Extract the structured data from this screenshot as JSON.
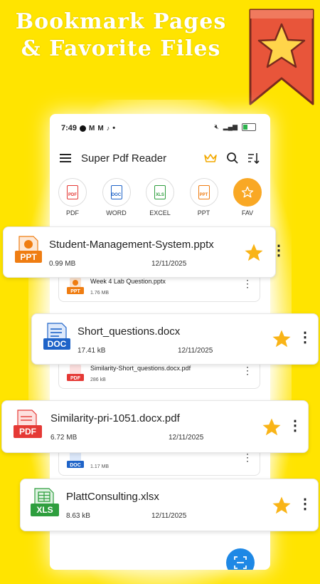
{
  "headline": {
    "line1": "Bookmark Pages",
    "line2": "& Favorite Files"
  },
  "status": {
    "time": "7:49",
    "dot": "•"
  },
  "app": {
    "title": "Super Pdf Reader"
  },
  "categories": [
    {
      "label": "PDF",
      "glyph": "PDF",
      "color": "#e53935"
    },
    {
      "label": "WORD",
      "glyph": "DOC",
      "color": "#1e63c8"
    },
    {
      "label": "EXCEL",
      "glyph": "XLS",
      "color": "#2e9e3e"
    },
    {
      "label": "PPT",
      "glyph": "PPT",
      "color": "#ef7d12"
    },
    {
      "label": "FAV",
      "glyph": "star",
      "color": "#f9a825"
    }
  ],
  "background_list": [
    {
      "name": "Week 4 Lab Question.pptx",
      "size": "1.76 MB",
      "type": "PPT"
    },
    {
      "name": "Similarity-Short_questions.docx.pdf",
      "size": "286 kB",
      "type": "PDF"
    },
    {
      "name": "",
      "size": "1.17 MB",
      "type": "DOC"
    }
  ],
  "featured_files": [
    {
      "name": "Student-Management-System.pptx",
      "size": "0.99 MB",
      "date": "12/11/2025",
      "type": "PPT"
    },
    {
      "name": "Short_questions.docx",
      "size": "17.41 kB",
      "date": "12/11/2025",
      "type": "DOC"
    },
    {
      "name": "Similarity-pri-1051.docx.pdf",
      "size": "6.72 MB",
      "date": "12/11/2025",
      "type": "PDF"
    },
    {
      "name": "PlattConsulting.xlsx",
      "size": "8.63 kB",
      "date": "12/11/2025",
      "type": "XLS"
    }
  ],
  "colors": {
    "background": "#ffe400",
    "ribbon": "#e8553a",
    "star": "#f9b417",
    "ppt": "#ef7d12",
    "doc": "#1e63c8",
    "pdf": "#e53935",
    "xls": "#2e9e3e",
    "fab": "#1e88e5"
  },
  "icons": [
    "menu-icon",
    "crown-icon",
    "search-icon",
    "sort-icon",
    "star-icon",
    "more-vert-icon",
    "scan-icon"
  ]
}
